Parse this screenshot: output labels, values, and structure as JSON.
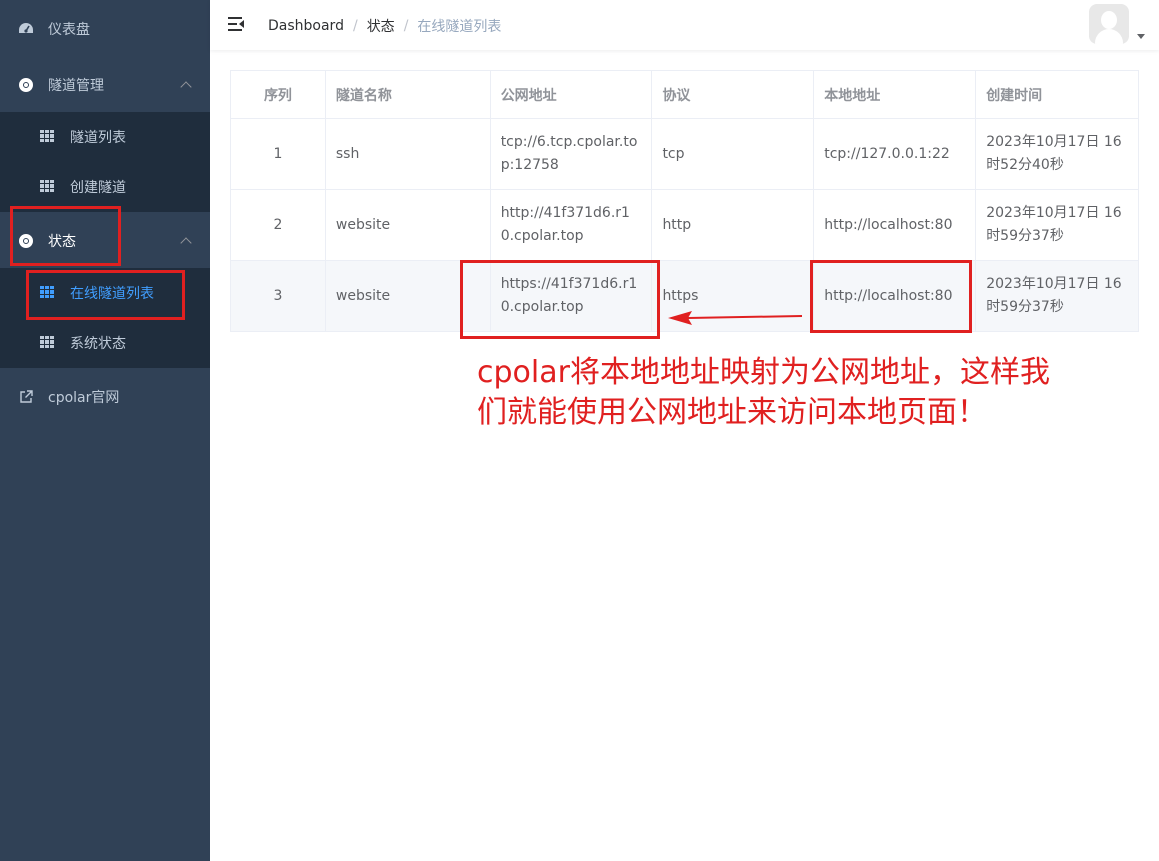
{
  "sidebar": {
    "items": [
      {
        "label": "仪表盘",
        "icon": "dashboard-icon"
      },
      {
        "label": "隧道管理",
        "icon": "tunnel-icon"
      },
      {
        "label": "隧道列表",
        "icon": "table-icon"
      },
      {
        "label": "创建隧道",
        "icon": "table-icon"
      },
      {
        "label": "状态",
        "icon": "status-icon"
      },
      {
        "label": "在线隧道列表",
        "icon": "table-icon"
      },
      {
        "label": "系统状态",
        "icon": "table-icon"
      },
      {
        "label": "cpolar官网",
        "icon": "external-link-icon"
      }
    ]
  },
  "header": {
    "breadcrumb": [
      "Dashboard",
      "状态",
      "在线隧道列表"
    ]
  },
  "table": {
    "columns": [
      "序列",
      "隧道名称",
      "公网地址",
      "协议",
      "本地地址",
      "创建时间"
    ],
    "rows": [
      [
        "1",
        "ssh",
        "tcp://6.tcp.cpolar.top:12758",
        "tcp",
        "tcp://127.0.0.1:22",
        "2023年10月17日 16时52分40秒"
      ],
      [
        "2",
        "website",
        "http://41f371d6.r10.cpolar.top",
        "http",
        "http://localhost:80",
        "2023年10月17日 16时59分37秒"
      ],
      [
        "3",
        "website",
        "https://41f371d6.r10.cpolar.top",
        "https",
        "http://localhost:80",
        "2023年10月17日 16时59分37秒"
      ]
    ]
  },
  "annotation": {
    "text": "cpolar将本地地址映射为公网地址，这样我们就能使用公网地址来访问本地页面！",
    "color": "#e02020"
  },
  "colors": {
    "sidebar_bg": "#304156",
    "submenu_bg": "#1f2d3d",
    "active": "#409eff",
    "annotation": "#e02020"
  }
}
